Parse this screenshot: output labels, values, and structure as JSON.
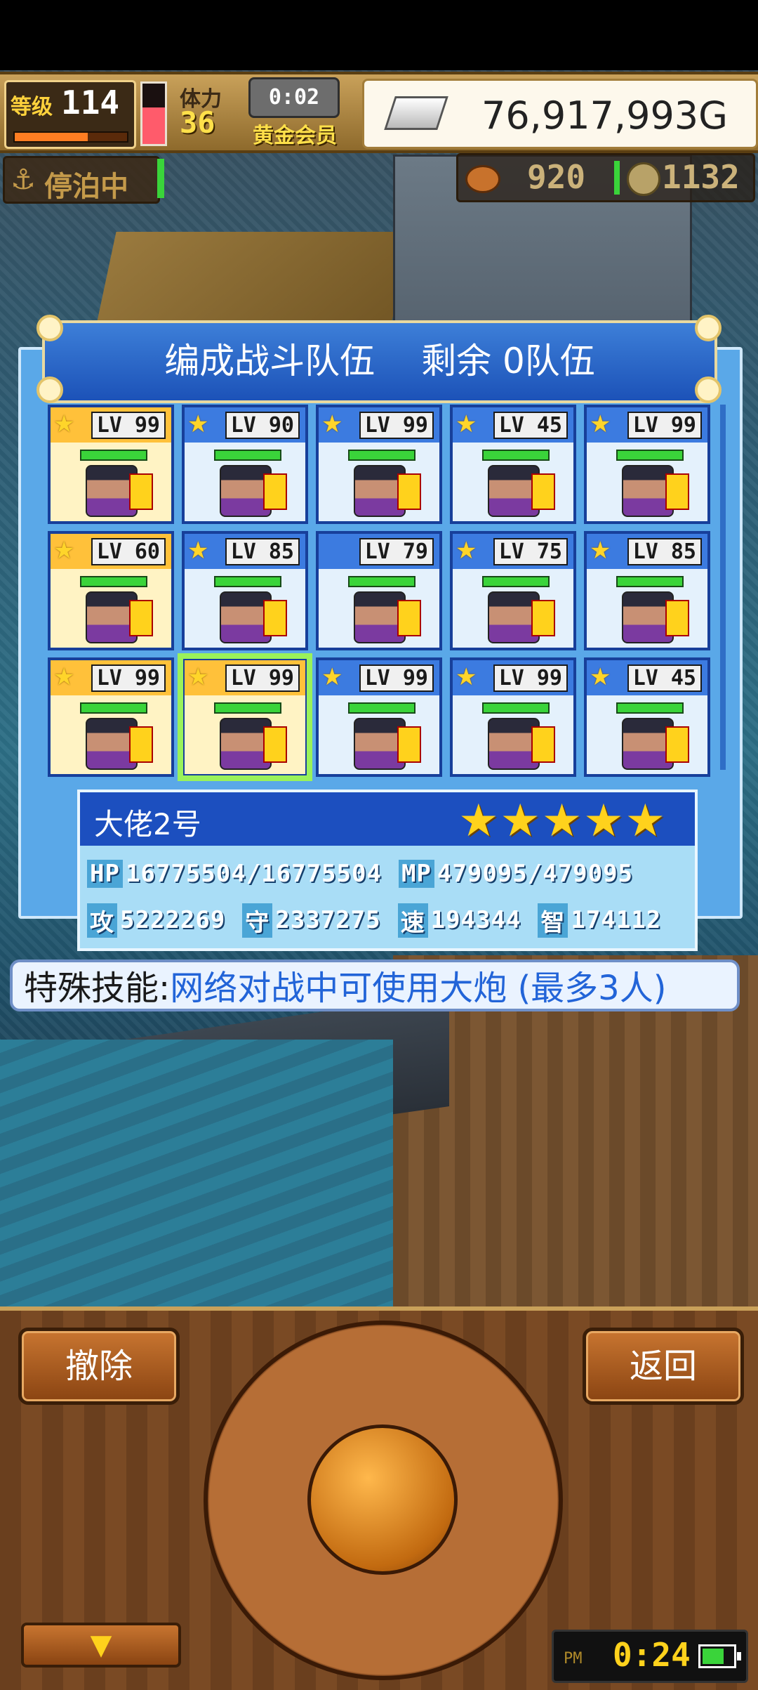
{
  "hud": {
    "level_label": "等级",
    "level_value": "114",
    "level_progress": 0.65,
    "stamina_label": "体力",
    "stamina_value": "36",
    "stamina_level": 0.6,
    "timer": "0:02",
    "member_label": "黄金会员",
    "gold": "76,917,993G"
  },
  "status": {
    "anchor_text": "停泊中",
    "anchor_icon": "anchor-icon",
    "resource1_icon": "coin-bag-icon",
    "resource1": "920",
    "resource2_icon": "medal-icon",
    "resource2": "1132"
  },
  "panel": {
    "title": "编成战斗队伍　 剩余 0队伍"
  },
  "slots": [
    {
      "lv": "LV 99",
      "star": true,
      "gold": true,
      "selected": false
    },
    {
      "lv": "LV 90",
      "star": true,
      "gold": false,
      "selected": false
    },
    {
      "lv": "LV 99",
      "star": true,
      "gold": false,
      "selected": false
    },
    {
      "lv": "LV 45",
      "star": true,
      "gold": false,
      "selected": false
    },
    {
      "lv": "LV 99",
      "star": true,
      "gold": false,
      "selected": false
    },
    {
      "lv": "LV 60",
      "star": true,
      "gold": true,
      "selected": false
    },
    {
      "lv": "LV 85",
      "star": true,
      "gold": false,
      "selected": false
    },
    {
      "lv": "LV 79",
      "star": false,
      "gold": false,
      "selected": false
    },
    {
      "lv": "LV 75",
      "star": true,
      "gold": false,
      "selected": false
    },
    {
      "lv": "LV 85",
      "star": true,
      "gold": false,
      "selected": false
    },
    {
      "lv": "LV 99",
      "star": true,
      "gold": true,
      "selected": false
    },
    {
      "lv": "LV 99",
      "star": true,
      "gold": true,
      "selected": true
    },
    {
      "lv": "LV 99",
      "star": true,
      "gold": false,
      "selected": false
    },
    {
      "lv": "LV 99",
      "star": true,
      "gold": false,
      "selected": false
    },
    {
      "lv": "LV 45",
      "star": true,
      "gold": false,
      "selected": false
    }
  ],
  "member": {
    "name": "大佬2号",
    "rating": "★★★★★",
    "hp": "16775504/16775504",
    "mp": "479095/479095",
    "atk": "5222269",
    "def": "2337275",
    "spd": "194344",
    "int": "174112",
    "hp_label": "HP",
    "mp_label": "MP",
    "atk_label": "攻",
    "def_label": "守",
    "spd_label": "速",
    "int_label": "智"
  },
  "skill": {
    "label": "特殊技能:",
    "value": "网络对战中可使用大炮 (最多3人)"
  },
  "controls": {
    "remove_label": "撤除",
    "back_label": "返回",
    "down_arrow": "▼"
  },
  "clock": {
    "ampm": "PM",
    "time": "0:24",
    "battery_level": 0.75
  },
  "colors": {
    "panel_blue": "#1c4fbf",
    "selection_green": "#9af25a",
    "gold_slot": "#ffc13a",
    "skill_text": "#2264d8"
  }
}
